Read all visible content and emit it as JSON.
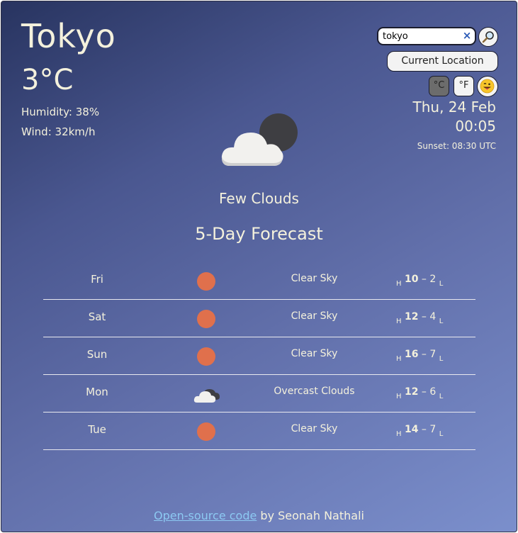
{
  "weather": {
    "city": "Tokyo",
    "temperature": "3°C",
    "humidity": "Humidity: 38%",
    "wind": "Wind: 32km/h",
    "description": "Few Clouds",
    "main_icon": "few-clouds-night-icon"
  },
  "controls": {
    "search_value": "tokyo",
    "clear_symbol": "×",
    "current_location_label": "Current Location",
    "unit_celsius": "°C",
    "unit_fahrenheit": "°F",
    "emoji_button_icon": "tongue-face-icon"
  },
  "datetime": {
    "date": "Thu, 24 Feb",
    "time": "00:05",
    "sunset": "Sunset: 08:30 UTC"
  },
  "forecast": {
    "title": "5-Day Forecast",
    "high_marker": "H",
    "low_marker": "L",
    "days": [
      {
        "day": "Fri",
        "icon": "sun-icon",
        "condition": "Clear Sky",
        "high": "10",
        "low": "2"
      },
      {
        "day": "Sat",
        "icon": "sun-icon",
        "condition": "Clear Sky",
        "high": "12",
        "low": "4"
      },
      {
        "day": "Sun",
        "icon": "sun-icon",
        "condition": "Clear Sky",
        "high": "16",
        "low": "7"
      },
      {
        "day": "Mon",
        "icon": "overcast-clouds-icon",
        "condition": "Overcast Clouds",
        "high": "12",
        "low": "6"
      },
      {
        "day": "Tue",
        "icon": "sun-icon",
        "condition": "Clear Sky",
        "high": "14",
        "low": "7"
      }
    ]
  },
  "footer": {
    "link_text": "Open-source code",
    "by_text": " by Seonah Nathali"
  },
  "colors": {
    "accent_sun": "#e0704c",
    "text": "#f4f1dc",
    "link": "#8cc9f2"
  }
}
